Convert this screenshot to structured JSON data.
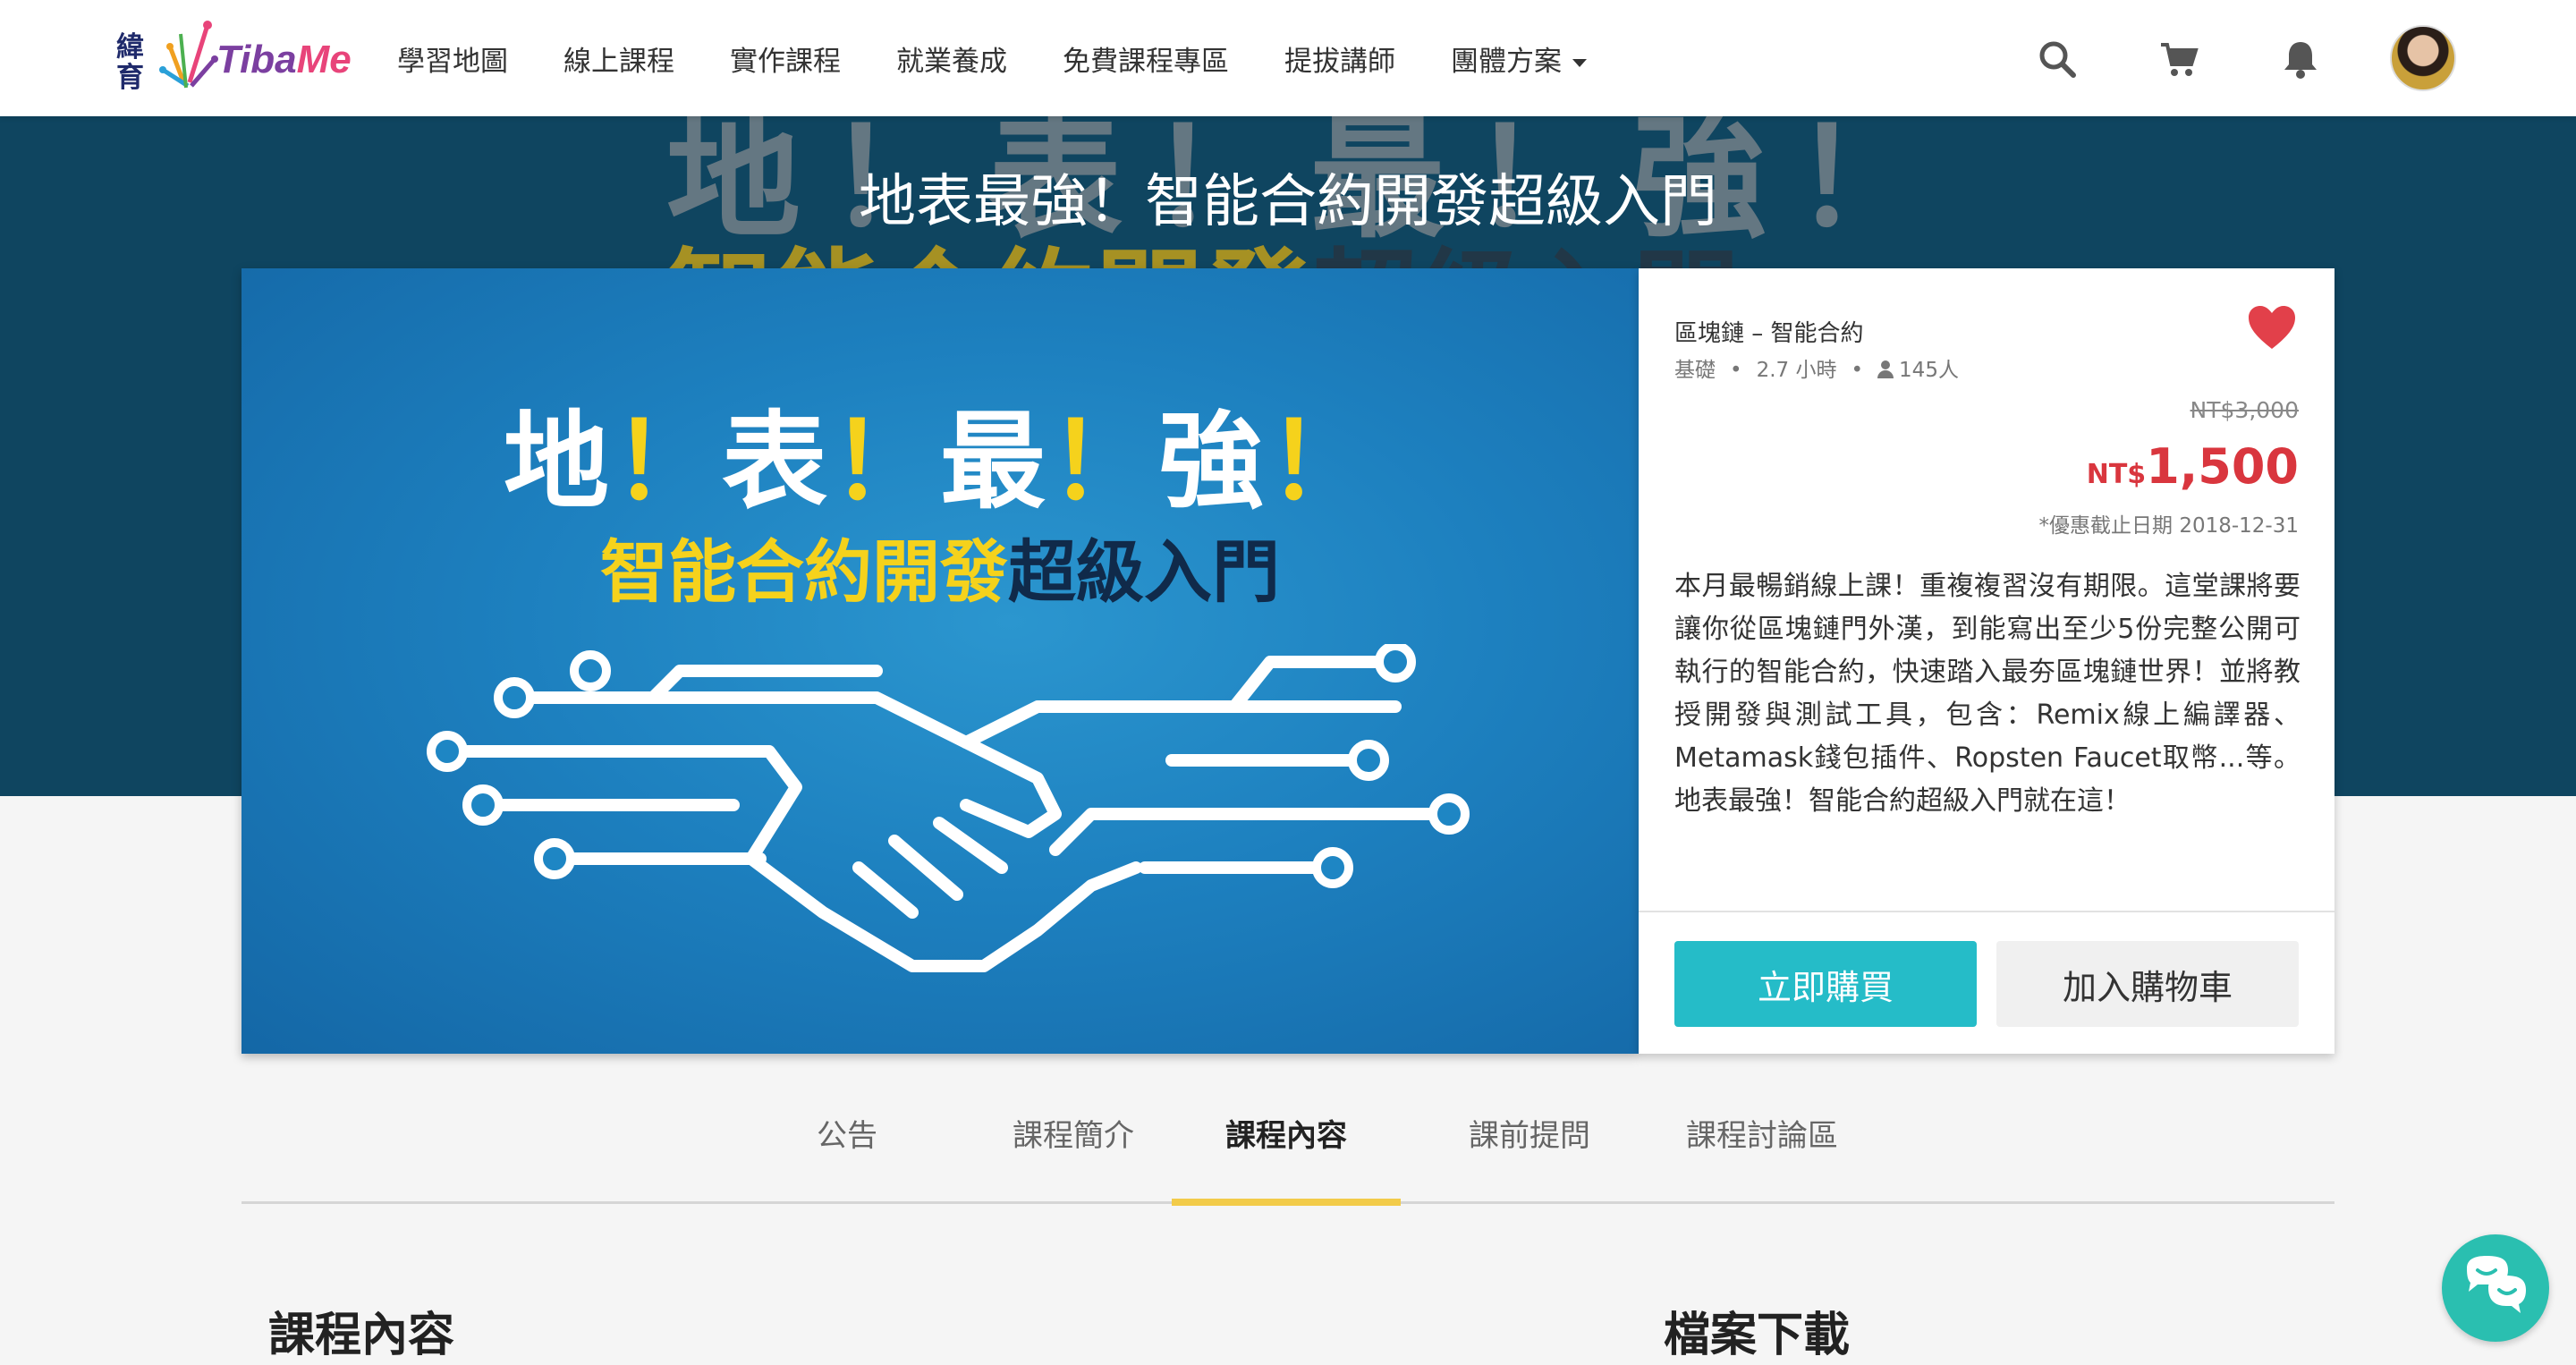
{
  "nav": {
    "logo_cn": "緯育",
    "logo_name_a": "Tiba",
    "logo_name_b": "Me",
    "menu": [
      "學習地圖",
      "線上課程",
      "實作課程",
      "就業養成",
      "免費課程專區",
      "提拔講師",
      "團體方案"
    ],
    "icons": [
      "search-icon",
      "cart-icon",
      "bell-icon"
    ]
  },
  "hero": {
    "title": "地表最強！智能合約開發超級入門",
    "bg_line1": "地！表！最！強！",
    "bg_line2a": "智能合約開發",
    "bg_line2b": "超級入門"
  },
  "course_image": {
    "line1": [
      "地",
      "！",
      "表",
      "！",
      "最",
      "！",
      "強",
      "！"
    ],
    "line2a": "智能合約開發",
    "line2b": "超級入門"
  },
  "course": {
    "category": "區塊鏈 – 智能合約",
    "level": "基礎",
    "hours": "2.7 小時",
    "students": "145人",
    "original_price": "NT$3,000",
    "price_currency": "NT$",
    "price": "1,500",
    "deadline": "*優惠截止日期 2018-12-31",
    "description": "本月最暢銷線上課！重複複習沒有期限。這堂課將要讓你從區塊鏈門外漢，到能寫出至少5份完整公開可執行的智能合約，快速踏入最夯區塊鏈世界！並將教授開發與測試工具，包含：Remix線上編譯器、Metamask錢包插件、Ropsten Faucet取幣...等。地表最強！智能合約超級入門就在這！",
    "buy_label": "立即購買",
    "cart_label": "加入購物車"
  },
  "tabs": [
    "公告",
    "課程簡介",
    "課程內容",
    "課前提問",
    "課程討論區"
  ],
  "active_tab": "課程內容",
  "sections": {
    "content_title": "課程內容",
    "download_title": "檔案下載"
  },
  "colors": {
    "accent": "#25bcc8",
    "price": "#d9363e",
    "tab_indicator": "#f2cb49",
    "hero_bg": "#0f4560"
  }
}
